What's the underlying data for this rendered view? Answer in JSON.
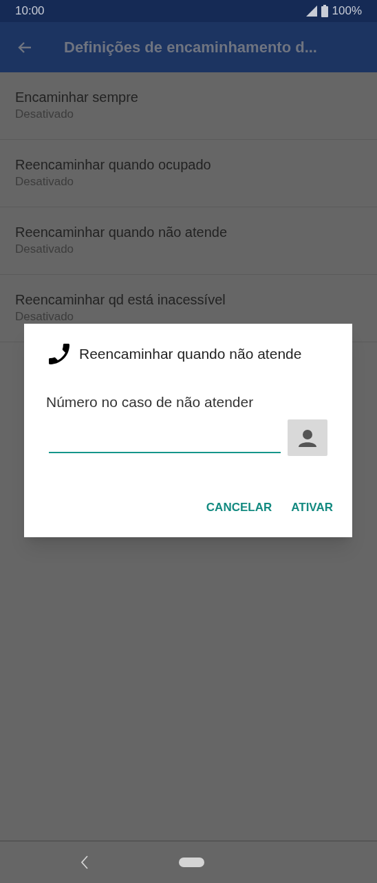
{
  "status_bar": {
    "time": "10:00",
    "battery": "100%"
  },
  "app_bar": {
    "title": "Definições de encaminhamento d..."
  },
  "settings": [
    {
      "title": "Encaminhar sempre",
      "summary": "Desativado"
    },
    {
      "title": "Reencaminhar quando ocupado",
      "summary": "Desativado"
    },
    {
      "title": "Reencaminhar quando não atende",
      "summary": "Desativado"
    },
    {
      "title": "Reencaminhar qd está inacessível",
      "summary": "Desativado"
    }
  ],
  "dialog": {
    "title": "Reencaminhar quando não atende",
    "field_label": "Número no caso de não atender",
    "buttons": [
      "CANCELAR",
      "ATIVAR"
    ]
  }
}
